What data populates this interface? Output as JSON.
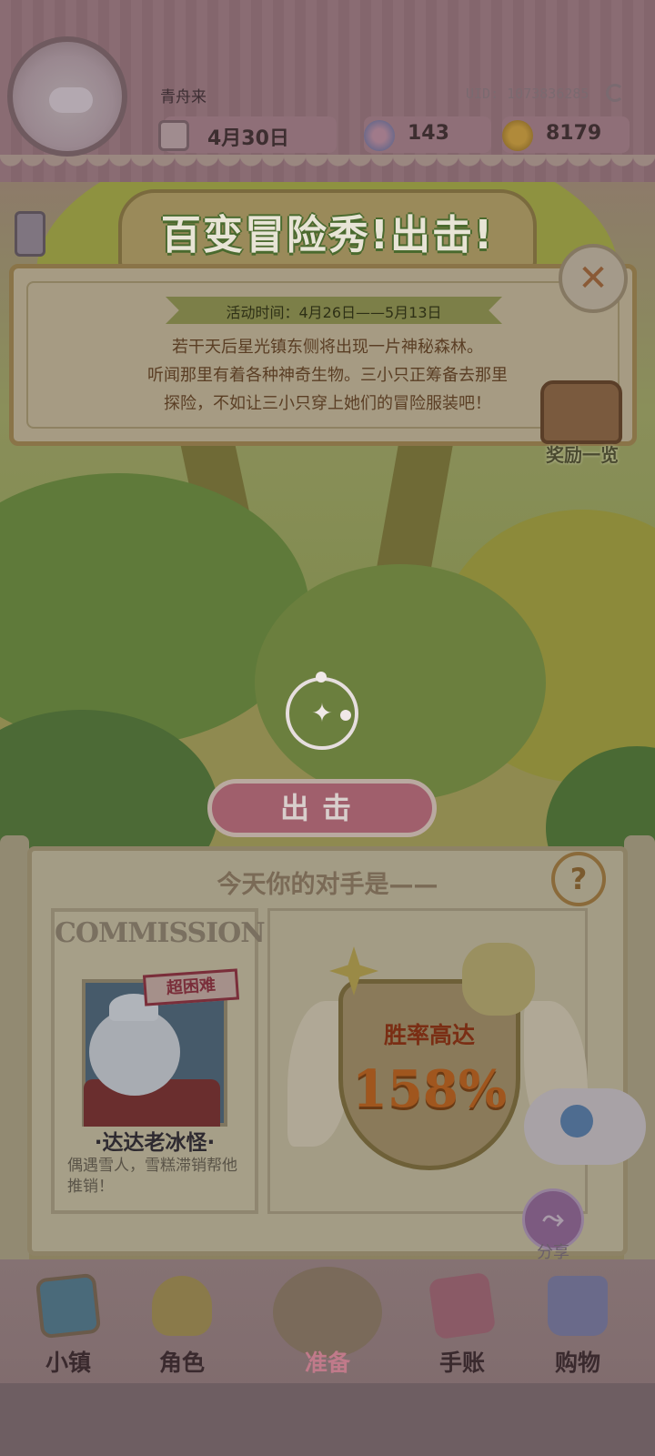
{
  "header": {
    "username": "青舟来",
    "uid": "UID: 1073836285",
    "date": "4月30日",
    "gems": "143",
    "coins": "8179"
  },
  "event": {
    "title": "百变冒险秀!出击!",
    "time": "活动时间：4月26日——5月13日",
    "description": [
      "若干天后星光镇东侧将出现一片神秘森林。",
      "听闻那里有着各种神奇生物。三小只正筹备去那里",
      "探险，不如让三小只穿上她们的冒险服装吧！"
    ],
    "reward_label": "奖励一览",
    "go_label": "出击"
  },
  "opponent": {
    "title": "今天你的对手是——",
    "help": "?",
    "commission_header": "COMMISSION",
    "difficulty_badge": "超困难",
    "name": "·达达老冰怪·",
    "description": "偶遇雪人，雪糕滞销帮他推销！",
    "win_label": "胜率高达",
    "win_value": "158%"
  },
  "share": {
    "label": "分享"
  },
  "nav": {
    "items": [
      {
        "label": "小镇",
        "icon": "map-icon"
      },
      {
        "label": "角色",
        "icon": "character-icon"
      },
      {
        "label": "准备",
        "icon": "prepare-icon",
        "active": true
      },
      {
        "label": "手账",
        "icon": "journal-icon"
      },
      {
        "label": "购物",
        "icon": "bag-icon"
      }
    ]
  },
  "colors": {
    "title_outline": "#4a6a2e",
    "go_button": "#a05f6c",
    "win_value": "#a0561e"
  }
}
